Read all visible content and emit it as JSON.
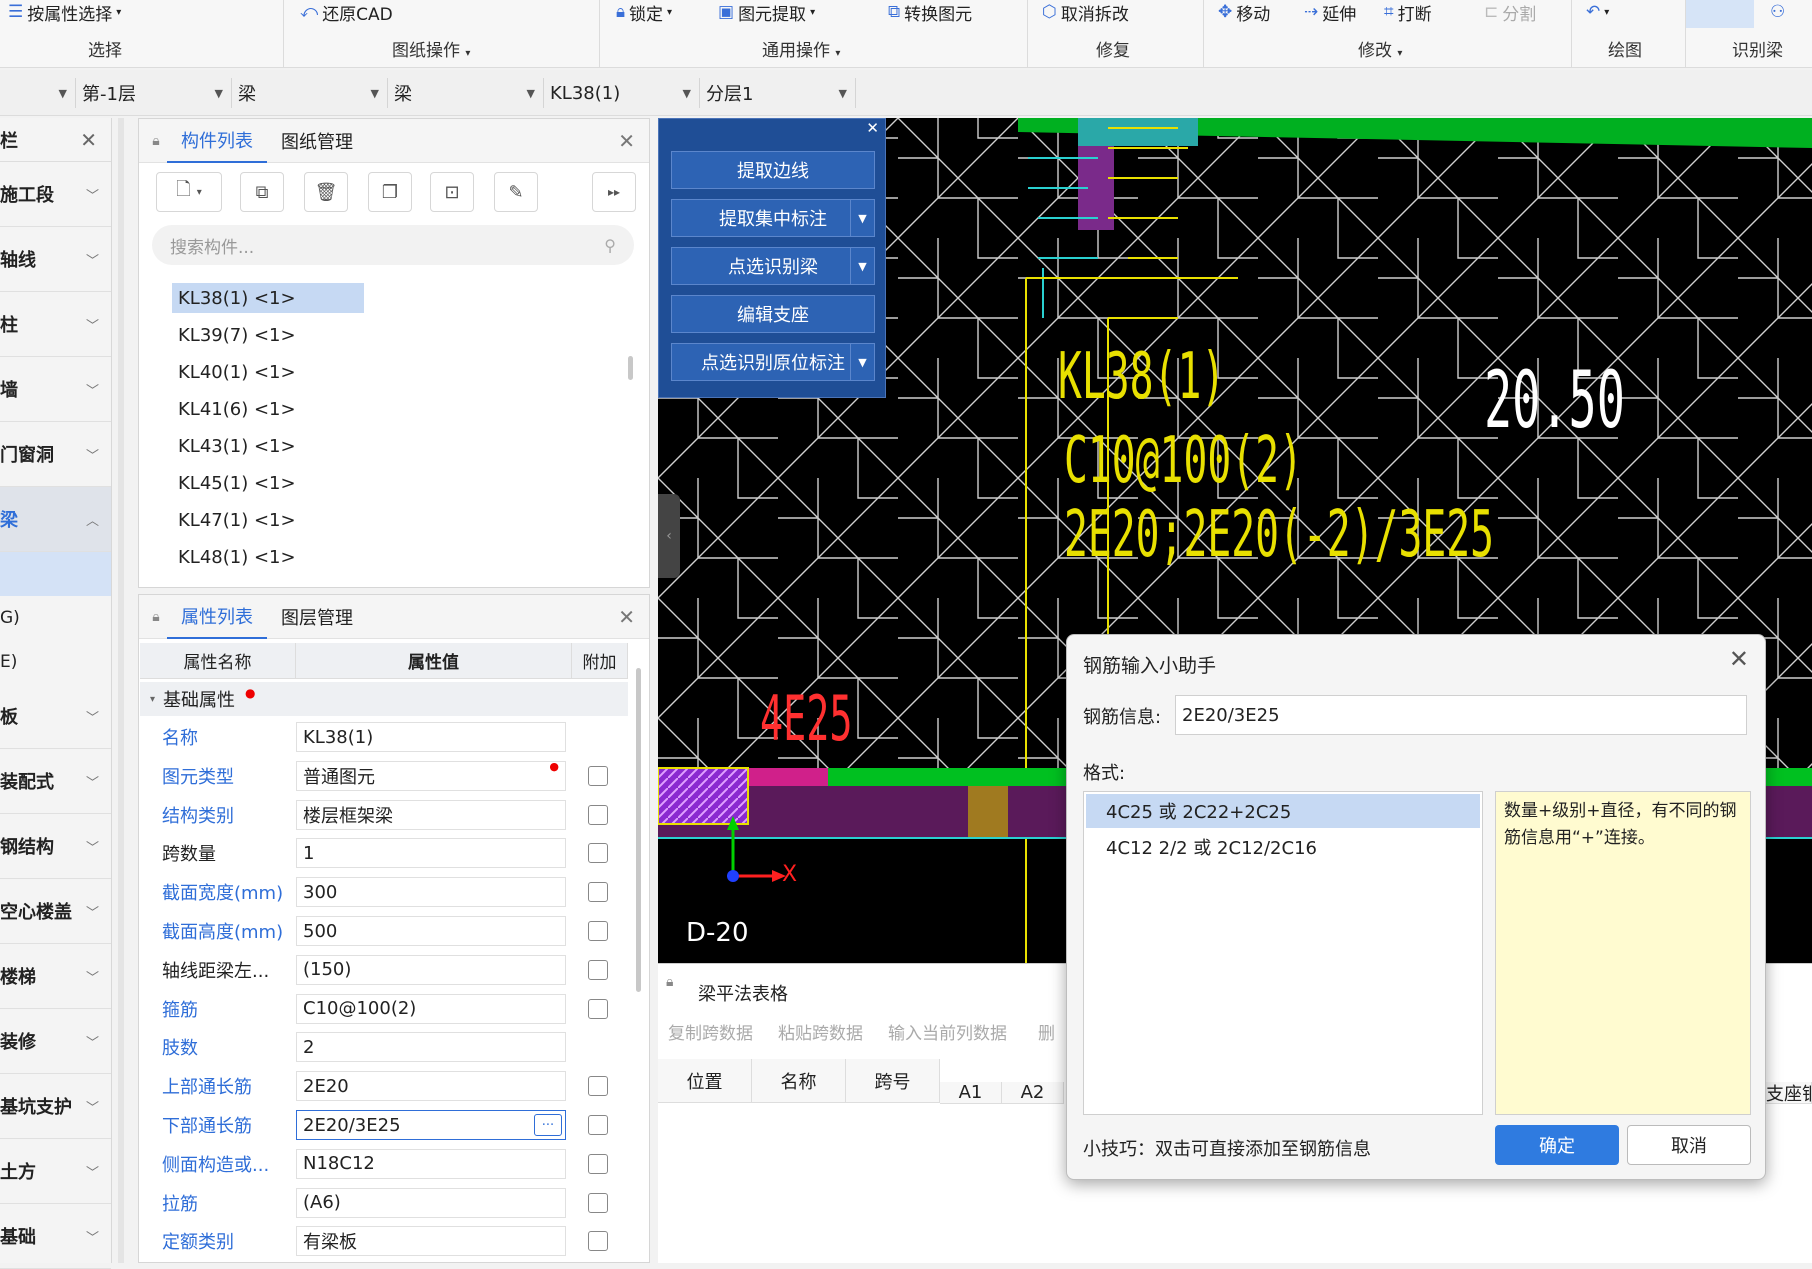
{
  "ribbon": {
    "groups": [
      {
        "label": "选择",
        "tools": [
          "按属性选择"
        ]
      },
      {
        "label": "图纸操作",
        "tools": [
          "还原CAD"
        ]
      },
      {
        "label": "通用操作",
        "tools": [
          "锁定",
          "图元提取",
          "转换图元"
        ]
      },
      {
        "label": "修复",
        "tools": [
          "取消拆改"
        ]
      },
      {
        "label": "修改",
        "tools": [
          "移动",
          "延伸",
          "打断",
          "分割"
        ]
      },
      {
        "label": "绘图",
        "tools": []
      },
      {
        "label": "识别梁",
        "tools": []
      }
    ]
  },
  "filters": {
    "floor": "第-1层",
    "type1": "梁",
    "type2": "梁",
    "member": "KL38(1)",
    "layer": "分层1"
  },
  "leftnav": {
    "title": "栏",
    "items": [
      "施工段",
      "轴线",
      "柱",
      "墙",
      "门窗洞",
      "梁"
    ],
    "subitems": [
      "G)",
      "E)"
    ],
    "items2": [
      "板",
      "装配式",
      "钢结构",
      "空心楼盖",
      "楼梯",
      "装修",
      "基坑支护",
      "土方",
      "基础"
    ]
  },
  "complist": {
    "tabs": [
      "构件列表",
      "图纸管理"
    ],
    "search_placeholder": "搜索构件...",
    "items": [
      "KL38(1) <1>",
      "KL39(7) <1>",
      "KL40(1) <1>",
      "KL41(6) <1>",
      "KL43(1) <1>",
      "KL45(1) <1>",
      "KL47(1) <1>",
      "KL48(1) <1>"
    ]
  },
  "props": {
    "tabs": [
      "属性列表",
      "图层管理"
    ],
    "headers": [
      "属性名称",
      "属性值",
      "附加"
    ],
    "group": "基础属性",
    "rows": [
      {
        "name": "名称",
        "value": "KL38(1)",
        "blue": true,
        "check": false
      },
      {
        "name": "图元类型",
        "value": "普通图元",
        "blue": true,
        "check": true
      },
      {
        "name": "结构类别",
        "value": "楼层框架梁",
        "blue": true,
        "check": true
      },
      {
        "name": "跨数量",
        "value": "1",
        "blue": false,
        "check": true
      },
      {
        "name": "截面宽度(mm)",
        "value": "300",
        "blue": true,
        "check": true
      },
      {
        "name": "截面高度(mm)",
        "value": "500",
        "blue": true,
        "check": true
      },
      {
        "name": "轴线距梁左...",
        "value": "(150)",
        "blue": false,
        "check": true
      },
      {
        "name": "箍筋",
        "value": "C10@100(2)",
        "blue": true,
        "check": true
      },
      {
        "name": "肢数",
        "value": "2",
        "blue": true,
        "check": false
      },
      {
        "name": "上部通长筋",
        "value": "2E20",
        "blue": true,
        "check": true
      },
      {
        "name": "下部通长筋",
        "value": "2E20/3E25",
        "blue": true,
        "check": true
      },
      {
        "name": "侧面构造或...",
        "value": "N18C12",
        "blue": true,
        "check": true
      },
      {
        "name": "拉筋",
        "value": "(A6)",
        "blue": true,
        "check": true
      },
      {
        "name": "定额类别",
        "value": "有梁板",
        "blue": true,
        "check": true
      }
    ]
  },
  "floatmenu": {
    "items": [
      "提取边线",
      "提取集中标注",
      "点选识别梁",
      "编辑支座",
      "点选识别原位标注"
    ]
  },
  "canvas": {
    "annotations": [
      "KL38(1)",
      "C10@100(2)",
      "2E20;2E20(-2)/3E25",
      "4E25",
      "20.50",
      "D-20",
      "X"
    ],
    "colors": {
      "background": "#000000",
      "hatch": "#cfcfcf",
      "text": "#e8e000",
      "red_text": "#ff3030",
      "green": "#00c020",
      "purple": "#5a1a5a",
      "magenta": "#d0208a"
    }
  },
  "bottomtable": {
    "title": "梁平法表格",
    "actions": [
      "复制跨数据",
      "粘贴跨数据",
      "输入当前列数据",
      "删"
    ],
    "columns": [
      "位置",
      "名称",
      "跨号",
      "A1",
      "A2",
      "支座钢"
    ]
  },
  "dialog": {
    "title": "钢筋输入小助手",
    "info_label": "钢筋信息:",
    "info_value": "2E20/3E25",
    "format_label": "格式:",
    "options": [
      "4C25 或 2C22+2C25",
      "4C12 2/2 或 2C12/2C16"
    ],
    "note": "数量+级别+直径，有不同的钢筋信息用“+”连接。",
    "tip": "小技巧：双击可直接添加至钢筋信息",
    "ok": "确定",
    "cancel": "取消"
  }
}
